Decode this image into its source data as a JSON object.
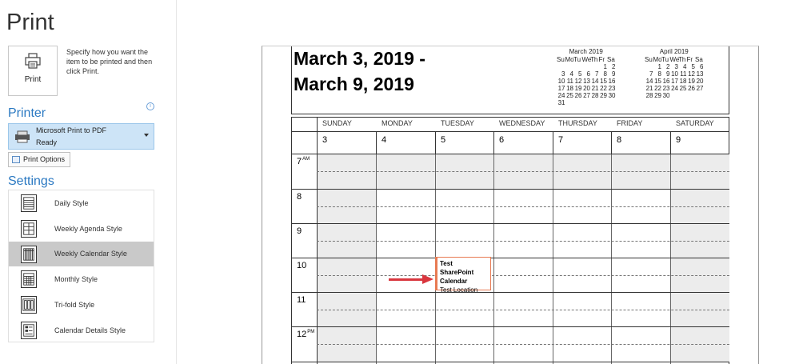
{
  "page": {
    "title": "Print"
  },
  "print_button": {
    "label": "Print",
    "icon": "printer-icon"
  },
  "print_description": "Specify how you want the item to be printed and then click Print.",
  "printer": {
    "heading": "Printer",
    "info_icon": "i",
    "name": "Microsoft Print to PDF",
    "status": "Ready",
    "options_label": "Print Options"
  },
  "settings": {
    "heading": "Settings",
    "styles": [
      {
        "label": "Daily Style",
        "icon": "daily-style-icon"
      },
      {
        "label": "Weekly Agenda Style",
        "icon": "weekly-agenda-style-icon"
      },
      {
        "label": "Weekly Calendar Style",
        "icon": "weekly-calendar-style-icon",
        "selected": true
      },
      {
        "label": "Monthly Style",
        "icon": "monthly-style-icon"
      },
      {
        "label": "Tri-fold Style",
        "icon": "trifold-style-icon"
      },
      {
        "label": "Calendar Details Style",
        "icon": "calendar-details-style-icon"
      }
    ]
  },
  "preview": {
    "date_range_line1": "March 3, 2019 -",
    "date_range_line2": "March 9, 2019",
    "mini_calendars": [
      {
        "title": "March 2019",
        "headers": [
          "Su",
          "Mo",
          "Tu",
          "We",
          "Th",
          "Fr",
          "Sa"
        ],
        "weeks": [
          [
            "",
            "",
            "",
            "",
            "",
            "1",
            "2"
          ],
          [
            "3",
            "4",
            "5",
            "6",
            "7",
            "8",
            "9"
          ],
          [
            "10",
            "11",
            "12",
            "13",
            "14",
            "15",
            "16"
          ],
          [
            "17",
            "18",
            "19",
            "20",
            "21",
            "22",
            "23"
          ],
          [
            "24",
            "25",
            "26",
            "27",
            "28",
            "29",
            "30"
          ],
          [
            "31",
            "",
            "",
            "",
            "",
            "",
            ""
          ]
        ]
      },
      {
        "title": "April 2019",
        "headers": [
          "Su",
          "Mo",
          "Tu",
          "We",
          "Th",
          "Fr",
          "Sa"
        ],
        "weeks": [
          [
            "",
            "1",
            "2",
            "3",
            "4",
            "5",
            "6"
          ],
          [
            "7",
            "8",
            "9",
            "10",
            "11",
            "12",
            "13"
          ],
          [
            "14",
            "15",
            "16",
            "17",
            "18",
            "19",
            "20"
          ],
          [
            "21",
            "22",
            "23",
            "24",
            "25",
            "26",
            "27"
          ],
          [
            "28",
            "29",
            "30",
            "",
            "",
            "",
            ""
          ]
        ]
      }
    ],
    "days": [
      {
        "name": "SUNDAY",
        "date": "3"
      },
      {
        "name": "MONDAY",
        "date": "4"
      },
      {
        "name": "TUESDAY",
        "date": "5"
      },
      {
        "name": "WEDNESDAY",
        "date": "6"
      },
      {
        "name": "THURSDAY",
        "date": "7"
      },
      {
        "name": "FRIDAY",
        "date": "8"
      },
      {
        "name": "SATURDAY",
        "date": "9"
      }
    ],
    "hours": [
      {
        "label": "7",
        "suffix": "AM"
      },
      {
        "label": "8",
        "suffix": ""
      },
      {
        "label": "9",
        "suffix": ""
      },
      {
        "label": "10",
        "suffix": ""
      },
      {
        "label": "11",
        "suffix": ""
      },
      {
        "label": "12",
        "suffix": "PM"
      }
    ],
    "event": {
      "title": "Test SharePoint Calendar",
      "location": "Test Location",
      "accent_color": "#e87a52"
    },
    "arrow_color": "#d9363e"
  }
}
